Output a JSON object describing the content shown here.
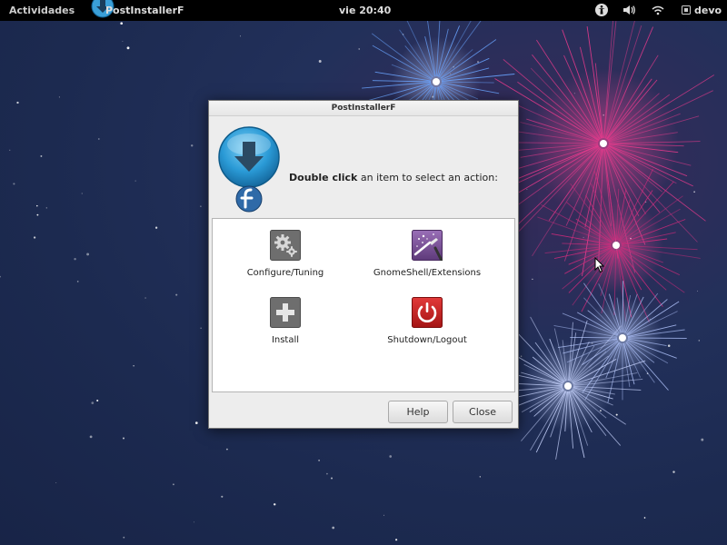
{
  "top_panel": {
    "activities_label": "Actividades",
    "app_name": "PostInstallerF",
    "clock": "vie 20:40",
    "tray_icons": [
      "accessibility-icon",
      "volume-icon",
      "wifi-icon"
    ],
    "user_name": "devo"
  },
  "dialog": {
    "title": "PostInstallerF",
    "prompt_bold": "Double click",
    "prompt_rest": " an item to select an action:",
    "actions": [
      {
        "label": "Configure/Tuning",
        "icon": "gears-icon",
        "color": "#6b6b6b"
      },
      {
        "label": "GnomeShell/Extensions",
        "icon": "magic-wand-icon",
        "color": "#7a4f96"
      },
      {
        "label": "Install",
        "icon": "plus-icon",
        "color": "#6b6b6b"
      },
      {
        "label": "Shutdown/Logout",
        "icon": "power-icon",
        "color": "#c92020"
      }
    ],
    "help_label": "Help",
    "close_label": "Close"
  },
  "colors": {
    "panel_bg": "#000000",
    "desktop_bg": "#1c2a50",
    "firework_pink": "#e0207a",
    "firework_blue": "#9fb6ff"
  }
}
